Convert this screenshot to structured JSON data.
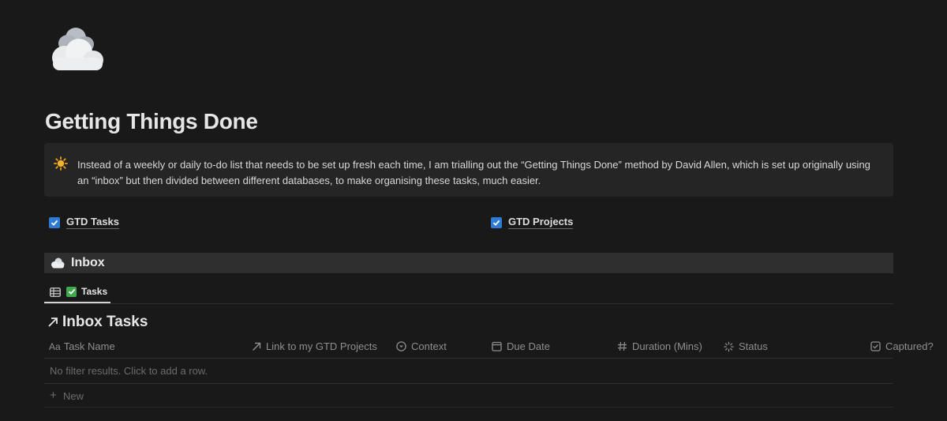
{
  "page": {
    "title": "Getting Things Done",
    "icon": "cloud-icon"
  },
  "callout": {
    "icon": "sun-icon",
    "text": "Instead of a weekly or daily to-do list that needs to be set up fresh each time, I am trialling out the “Getting Things Done” method by David Allen, which is set up originally using an “inbox” but then divided between different databases, to make organising these tasks, much easier."
  },
  "links": [
    {
      "label": "GTD Tasks",
      "checked": true
    },
    {
      "label": "GTD Projects",
      "checked": true
    }
  ],
  "inbox": {
    "label": "Inbox",
    "icon": "cloud-icon"
  },
  "view_tab": {
    "label": "Tasks",
    "icon": "table-icon",
    "emoji": "check-mark-icon"
  },
  "database": {
    "title": "Inbox Tasks",
    "icon": "arrow-up-right-icon",
    "columns": [
      {
        "label": "Task Name",
        "icon": "text-icon",
        "prefix": "Aa"
      },
      {
        "label": "Link to my GTD Projects",
        "icon": "relation-arrow-icon"
      },
      {
        "label": "Context",
        "icon": "select-icon"
      },
      {
        "label": "Due Date",
        "icon": "calendar-icon"
      },
      {
        "label": "Duration (Mins)",
        "icon": "number-icon"
      },
      {
        "label": "Status",
        "icon": "status-icon"
      },
      {
        "label": "Captured?",
        "icon": "checkbox-icon"
      }
    ],
    "empty_message": "No filter results. Click to add a row.",
    "new_label": "New"
  },
  "colors": {
    "background": "#191919",
    "callout_bg": "#252525",
    "checkbox_blue": "#2e7bd6",
    "check_green": "#3ea94e"
  }
}
